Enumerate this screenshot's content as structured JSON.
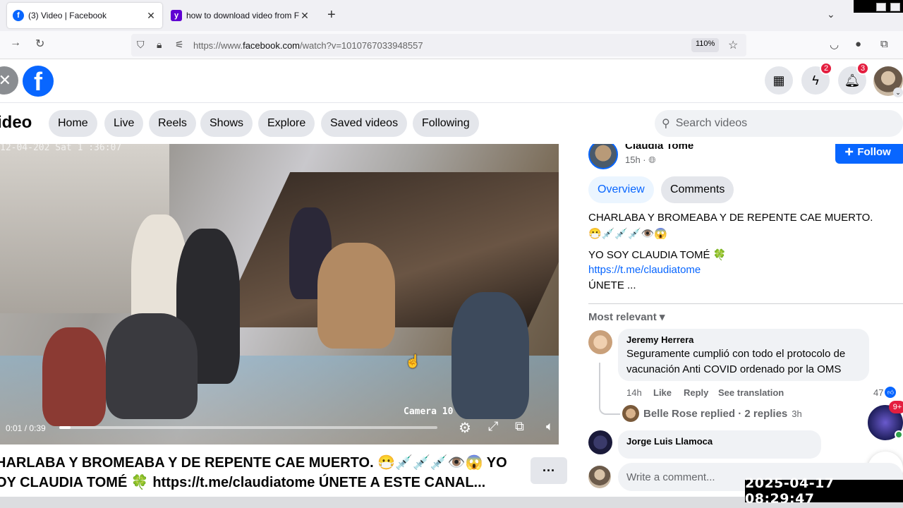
{
  "browser": {
    "tabs": [
      {
        "title": "(3) Video | Facebook",
        "active": true,
        "favicon": "facebook-icon"
      },
      {
        "title": "how to download video from F",
        "active": false,
        "favicon": "yahoo-icon"
      }
    ],
    "url_prefix": "https://www.",
    "url_domain": "facebook.com",
    "url_path": "/watch?v=1010767033948557",
    "zoom": "110%"
  },
  "header": {
    "logo": "f",
    "messenger_badge": "2",
    "notifications_badge": "3"
  },
  "video_nav": {
    "title": "ideo",
    "pills": [
      "Home",
      "Live",
      "Reels",
      "Shows",
      "Explore",
      "Saved videos",
      "Following"
    ],
    "search_placeholder": "Search videos"
  },
  "video": {
    "watermark": "12-04-202  Sat 1 :36:07",
    "camera_label": "Camera 10",
    "time": "0:01 / 0:39",
    "progress": 0.03
  },
  "caption": {
    "line1": "HARLABA Y BROMEABA Y DE REPENTE CAE MUERTO. 😷💉💉💉👁️😱 YO",
    "line2": "OY CLAUDIA TOMÉ 🍀 https://t.me/claudiatome ÚNETE A ESTE CANAL..."
  },
  "post": {
    "author": "Claudia Tomé",
    "time": "15h ·",
    "follow_label": "Follow",
    "tabs": [
      "Overview",
      "Comments"
    ],
    "text1": "CHARLABA Y BROMEABA Y DE REPENTE CAE MUERTO.",
    "emoji_line": "😷💉💉💉👁️😱",
    "text2": "YO SOY CLAUDIA TOMÉ 🍀",
    "link": "https://t.me/claudiatome",
    "text3": "ÚNETE ..."
  },
  "comments": {
    "sort_label": "Most relevant",
    "items": [
      {
        "author": "Jeremy Herrera",
        "body": "Seguramente cumplió con todo el protocolo de vacunación Anti COVID ordenado por la OMS",
        "time": "14h",
        "like": "Like",
        "reply": "Reply",
        "translate": "See translation",
        "likes": "47",
        "replies_summary": "Belle Rose replied · 2 replies",
        "replies_time": "3h"
      },
      {
        "author": "Jorge Luis Llamoca"
      }
    ],
    "write_placeholder": "Write a comment...",
    "floating_badge": "9+"
  },
  "timestamp": "2025-04-17  08:29:47"
}
